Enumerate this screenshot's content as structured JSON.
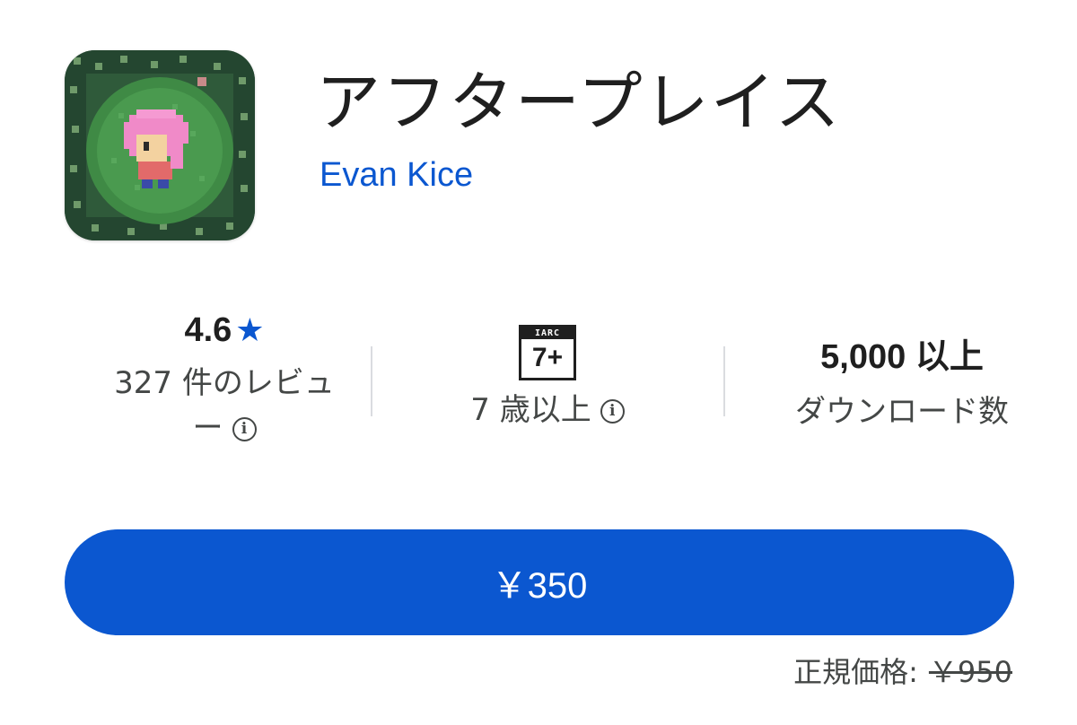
{
  "app": {
    "title": "アフタープレイス",
    "developer": "Evan Kice",
    "icon": "pixel-art-app-icon"
  },
  "stats": {
    "rating": {
      "value": "4.6",
      "star": "★",
      "label": "327 件のレビュー"
    },
    "content_rating": {
      "badge_top": "IARC",
      "badge_age": "7+",
      "label": "7 歳以上"
    },
    "downloads": {
      "value": "5,000 以上",
      "label": "ダウンロード数"
    },
    "info_icon": "i"
  },
  "purchase": {
    "button_label": "￥350",
    "regular_label": "正規価格:",
    "regular_price": "￥950"
  },
  "colors": {
    "accent": "#0b57d0",
    "text": "#1f1f1f",
    "secondary_text": "#444746",
    "divider": "#dadce0"
  }
}
